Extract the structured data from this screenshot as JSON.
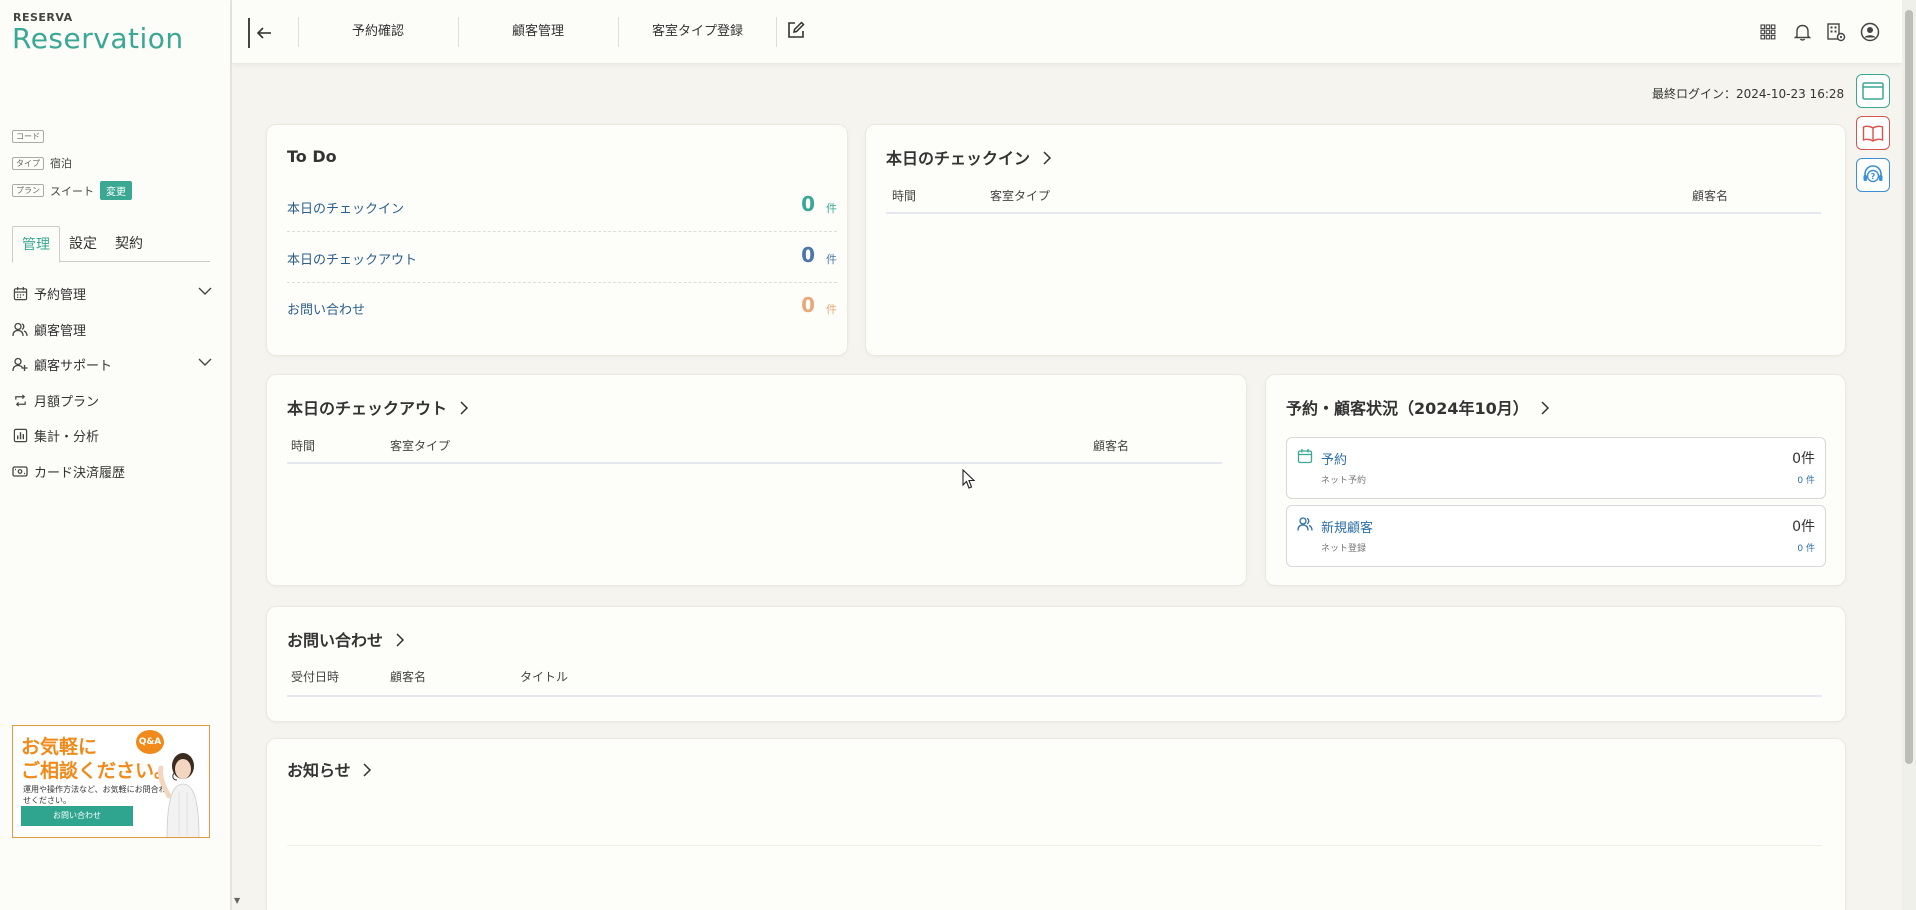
{
  "brand": {
    "sub": "RESERVA",
    "name": "Reservation"
  },
  "info": {
    "code_tag": "コード",
    "type_tag": "タイプ",
    "type_value": "宿泊",
    "plan_tag": "プラン",
    "plan_value": "スイート",
    "change_label": "変更"
  },
  "sidebar_tabs": [
    "管理",
    "設定",
    "契約"
  ],
  "nav": [
    {
      "label": "予約管理",
      "icon": "calendar-icon",
      "expandable": true
    },
    {
      "label": "顧客管理",
      "icon": "users-icon",
      "expandable": false
    },
    {
      "label": "顧客サポート",
      "icon": "user-add-icon",
      "expandable": true
    },
    {
      "label": "月額プラン",
      "icon": "repeat-icon",
      "expandable": false
    },
    {
      "label": "集計・分析",
      "icon": "bar-chart-icon",
      "expandable": false
    },
    {
      "label": "カード決済履歴",
      "icon": "card-icon",
      "expandable": false
    }
  ],
  "banner": {
    "line1": "お気軽に",
    "line2": "ご相談ください。",
    "line3": "運用や操作方法など、お気軽にお問合わせください。",
    "button": "お問い合わせ",
    "qa": "Q&A"
  },
  "header": {
    "links": [
      "予約確認",
      "顧客管理",
      "客室タイプ登録"
    ]
  },
  "last_login": "最終ログイン：2024-10-23 16:28",
  "todo": {
    "title": "To Do",
    "unit": "件",
    "rows": [
      {
        "label": "本日のチェックイン",
        "value": "0",
        "color": "#3aa893"
      },
      {
        "label": "本日のチェックアウト",
        "value": "0",
        "color": "#4a76a8"
      },
      {
        "label": "お問い合わせ",
        "value": "0",
        "color": "#e8a97a"
      }
    ]
  },
  "checkin": {
    "title": "本日のチェックイン",
    "columns": [
      "時間",
      "客室タイプ",
      "顧客名"
    ]
  },
  "checkout": {
    "title": "本日のチェックアウト",
    "columns": [
      "時間",
      "客室タイプ",
      "顧客名"
    ]
  },
  "status": {
    "title": "予約・顧客状況（2024年10月）",
    "items": [
      {
        "label": "予約",
        "sub": "ネット予約",
        "value": "0件",
        "subvalue": "0 件"
      },
      {
        "label": "新規顧客",
        "sub": "ネット登録",
        "value": "0件",
        "subvalue": "0 件"
      }
    ]
  },
  "inquiries": {
    "title": "お問い合わせ",
    "columns": [
      "受付日時",
      "顧客名",
      "タイトル"
    ]
  },
  "notices": {
    "title": "お知らせ"
  }
}
